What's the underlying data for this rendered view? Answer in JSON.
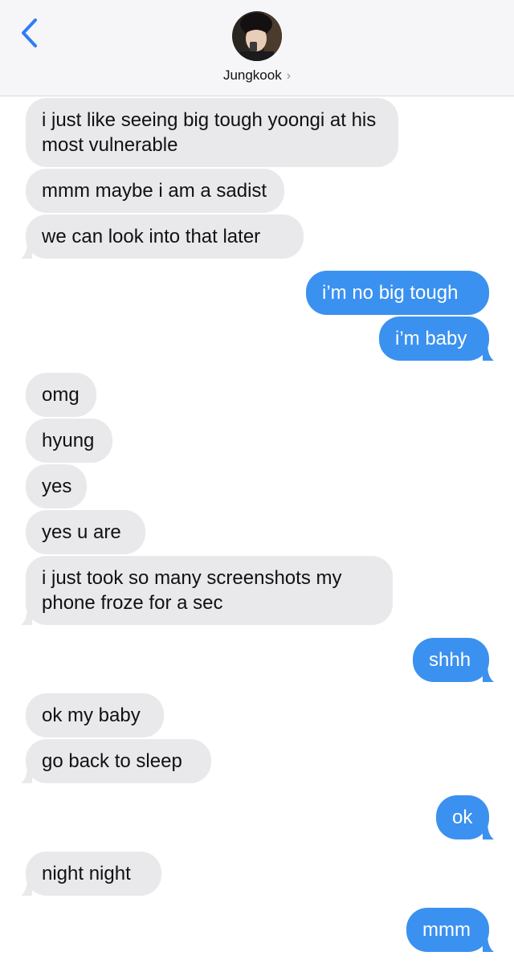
{
  "header": {
    "contact_name": "Jungkook",
    "back_icon": "chevron-left-icon",
    "disclosure_icon": "chevron-right-icon"
  },
  "colors": {
    "incoming_bubble": "#e9e9eb",
    "outgoing_bubble": "#3b91ef",
    "accent": "#2f7cf6"
  },
  "messages": [
    {
      "dir": "in",
      "text": "i just like seeing big tough yoongi at his most vulnerable"
    },
    {
      "dir": "in",
      "text": "mmm maybe i am a sadist"
    },
    {
      "dir": "in",
      "text": "we can look into that later"
    },
    {
      "dir": "out",
      "text": "i’m no big tough"
    },
    {
      "dir": "out",
      "text": "i’m baby"
    },
    {
      "dir": "in",
      "text": "omg"
    },
    {
      "dir": "in",
      "text": "hyung"
    },
    {
      "dir": "in",
      "text": "yes"
    },
    {
      "dir": "in",
      "text": "yes u are"
    },
    {
      "dir": "in",
      "text": "i just took so many screenshots my phone froze for a sec"
    },
    {
      "dir": "out",
      "text": "shhh"
    },
    {
      "dir": "in",
      "text": "ok my baby"
    },
    {
      "dir": "in",
      "text": "go back to sleep"
    },
    {
      "dir": "out",
      "text": "ok"
    },
    {
      "dir": "in",
      "text": "night night"
    },
    {
      "dir": "out",
      "text": "mmm"
    }
  ]
}
